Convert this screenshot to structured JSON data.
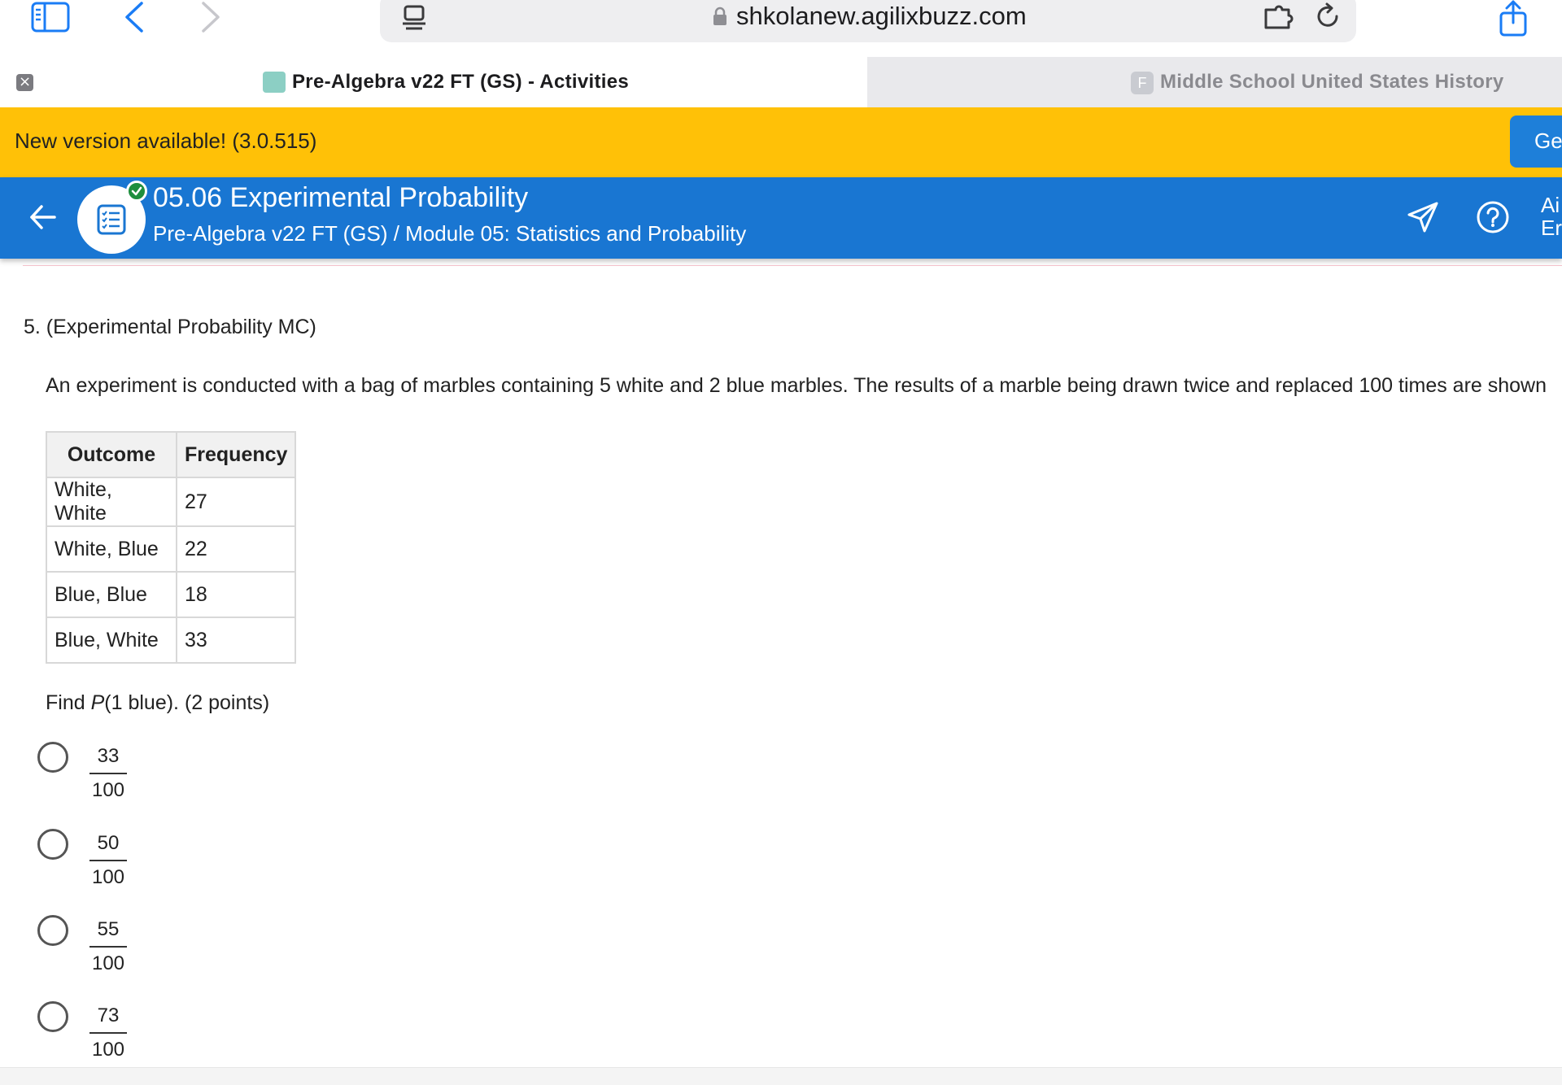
{
  "browser": {
    "url": "shkolanew.agilixbuzz.com",
    "tabs": [
      {
        "title": "Pre-Algebra v22 FT (GS) - Activities",
        "active": true
      },
      {
        "title": "Middle School United States History",
        "favicon_letter": "F",
        "active": false
      }
    ],
    "close_glyph": "×"
  },
  "banner": {
    "text": "New version available! (3.0.515)",
    "button_label": "Get"
  },
  "header": {
    "title": "05.06 Experimental Probability",
    "breadcrumb": "Pre-Algebra v22 FT (GS) / Module 05: Statistics and Probability",
    "user_line1": "Ai",
    "user_line2": "Er",
    "color": "#1976d2"
  },
  "question": {
    "number_label": "5. (Experimental Probability MC)",
    "prompt": "An experiment is conducted with a bag of marbles containing 5 white and 2 blue marbles. The results of a marble being drawn twice and replaced 100 times are shown",
    "table": {
      "headers": [
        "Outcome",
        "Frequency"
      ],
      "rows": [
        [
          "White, White",
          "27"
        ],
        [
          "White, Blue",
          "22"
        ],
        [
          "Blue, Blue",
          "18"
        ],
        [
          "Blue, White",
          "33"
        ]
      ]
    },
    "find_prefix": "Find ",
    "find_var": "P",
    "find_rest": "(1 blue). (2 points)",
    "options": [
      {
        "numerator": "33",
        "denominator": "100",
        "selected": false
      },
      {
        "numerator": "50",
        "denominator": "100",
        "selected": false
      },
      {
        "numerator": "55",
        "denominator": "100",
        "selected": false
      },
      {
        "numerator": "73",
        "denominator": "100",
        "selected": false
      }
    ]
  }
}
